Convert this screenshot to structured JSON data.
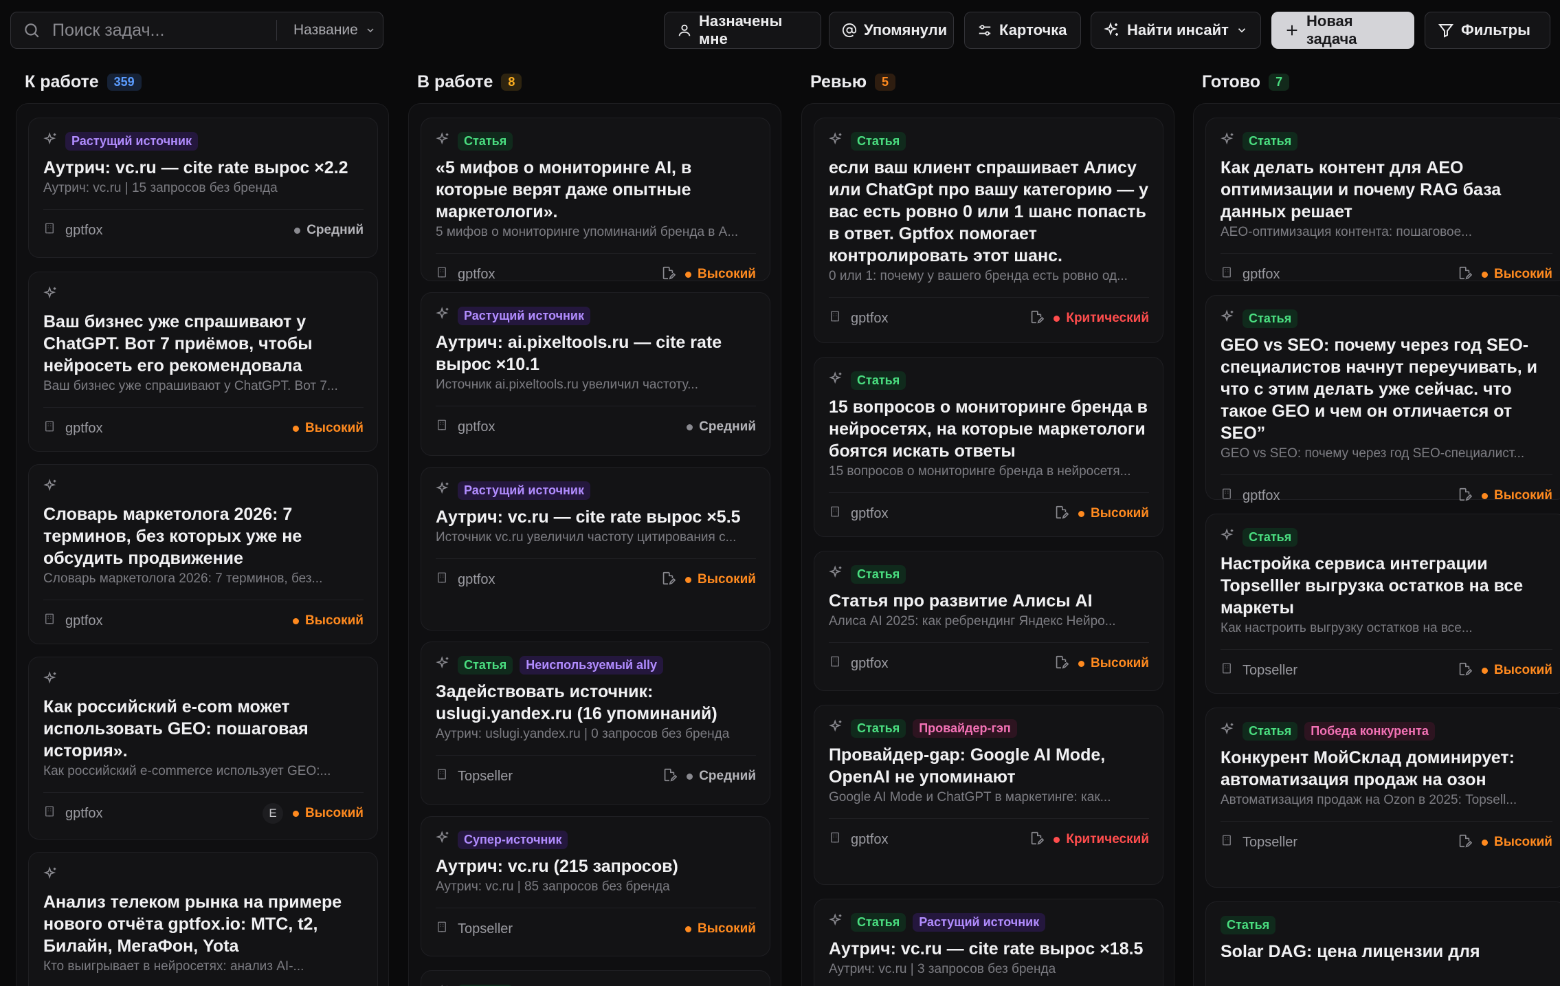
{
  "toolbar": {
    "search_placeholder": "Поиск задач...",
    "search_field": "Название",
    "assigned_label": "Назначены мне",
    "mentioned_label": "Упомянули",
    "card_label": "Карточка",
    "insight_label": "Найти инсайт",
    "new_task_label": "Новая задача",
    "filters_label": "Фильтры"
  },
  "colors": {
    "priority_high": "#ff8a1f",
    "priority_critical": "#ff4d4d",
    "priority_medium": "#8a8a90",
    "count_todo": "#5b9cff",
    "count_progress": "#ffb020",
    "count_review": "#ff8a1f",
    "count_done": "#4ade80"
  },
  "columns": [
    {
      "title": "К работе",
      "count": "359",
      "cards": [
        {
          "tags": [
            "Растущий источник"
          ],
          "title": "Аутрич: vc.ru — cite rate вырос ×2.2",
          "desc": "Аутрич: vc.ru | 15 запросов без бренда",
          "project": "gptfox",
          "priority": "Средний"
        },
        {
          "tags": [],
          "title": "Ваш бизнес уже спрашивают у ChatGPT. Вот 7 приёмов, чтобы нейросеть его рекомендовала",
          "desc": "Ваш бизнес уже спрашивают у ChatGPT. Вот 7...",
          "project": "gptfox",
          "priority": "Высокий"
        },
        {
          "tags": [],
          "title": "Словарь маркетолога 2026: 7 терминов, без которых уже не обсудить продвижение",
          "desc": "Словарь маркетолога 2026: 7 терминов, без...",
          "project": "gptfox",
          "priority": "Высокий"
        },
        {
          "tags": [],
          "title": "Как российский e-com может использовать GEO: пошаговая история».",
          "desc": "Как российский e-commerce использует GEO:...",
          "project": "gptfox",
          "avatar": "E",
          "priority": "Высокий"
        },
        {
          "tags": [],
          "title": "Анализ телеком рынка на примере нового отчёта gptfox.io: МТС, t2, Билайн, МегаФон, Yota",
          "desc": "Кто выигрывает в нейросетях: анализ AI-..."
        }
      ]
    },
    {
      "title": "В работе",
      "count": "8",
      "cards": [
        {
          "tags": [
            "Статья"
          ],
          "title": "«5 мифов о мониторинге AI, в которые верят даже опытные маркетологи».",
          "desc": "5 мифов о мониторинге упоминаний бренда в А...",
          "project": "gptfox",
          "priority": "Высокий"
        },
        {
          "tags": [
            "Растущий источник"
          ],
          "title": "Аутрич: ai.pixeltools.ru — cite rate вырос ×10.1",
          "desc": "Источник ai.pixeltools.ru увеличил частоту...",
          "project": "gptfox",
          "priority": "Средний"
        },
        {
          "tags": [
            "Растущий источник"
          ],
          "title": "Аутрич: vc.ru — cite rate вырос ×5.5",
          "desc": "Источник vc.ru увеличил частоту цитирования с...",
          "project": "gptfox",
          "priority": "Высокий"
        },
        {
          "tags": [
            "Статья",
            "Неиспользуемый ally"
          ],
          "title": "Задействовать источник: uslugi.yandex.ru (16 упоминаний)",
          "desc": "Аутрич: uslugi.yandex.ru | 0 запросов без бренда",
          "project": "Topseller",
          "priority": "Средний"
        },
        {
          "tags": [
            "Супер-источник"
          ],
          "title": "Аутрич: vc.ru (215 запросов)",
          "desc": "Аутрич: vc.ru | 85 запросов без бренда",
          "project": "Topseller",
          "priority": "Высокий"
        },
        {
          "tags": [
            "Статья"
          ]
        }
      ]
    },
    {
      "title": "Ревью",
      "count": "5",
      "cards": [
        {
          "tags": [
            "Статья"
          ],
          "title": "если ваш клиент спрашивает Алису или ChatGpt про вашу категорию — у вас есть ровно 0 или 1 шанс попасть в ответ. Gptfox помогает контролировать этот шанс.",
          "desc": "0 или 1: почему у вашего бренда есть ровно од...",
          "project": "gptfox",
          "priority": "Критический"
        },
        {
          "tags": [
            "Статья"
          ],
          "title": "15 вопросов о мониторинге бренда в нейросетях, на которые маркетологи боятся искать ответы",
          "desc": "15 вопросов о мониторинге бренда в нейросетя...",
          "project": "gptfox",
          "priority": "Высокий"
        },
        {
          "tags": [
            "Статья"
          ],
          "title": "Статья про развитие Алисы AI",
          "desc": "Алиса AI 2025: как ребрендинг Яндекс Нейро...",
          "project": "gptfox",
          "priority": "Высокий"
        },
        {
          "tags": [
            "Статья",
            "Провайдер-гэп"
          ],
          "title": "Провайдер-gap: Google AI Mode, OpenAI не упоминают",
          "desc": "Google AI Mode и ChatGPT в маркетинге: как...",
          "project": "gptfox",
          "priority": "Критический"
        },
        {
          "tags": [
            "Статья",
            "Растущий источник"
          ],
          "title": "Аутрич: vc.ru — cite rate вырос ×18.5",
          "desc": "Аутрич: vc.ru | 3 запросов без бренда"
        }
      ]
    },
    {
      "title": "Готово",
      "count": "7",
      "cards": [
        {
          "tags": [
            "Статья"
          ],
          "title": "Как делать контент для AEO оптимизации и почему RAG база данных решает",
          "desc": "AEO-оптимизация контента: пошаговое...",
          "project": "gptfox",
          "priority": "Высокий"
        },
        {
          "tags": [
            "Статья"
          ],
          "title": "GEO vs SEO: почему через год SEO-специалистов начнут переучивать, и что с этим делать уже сейчас. что такое GEO и чем он отличается от SEO”",
          "desc": "GEO vs SEO: почему через год SEO-специалист...",
          "project": "gptfox",
          "priority": "Высокий"
        },
        {
          "tags": [
            "Статья"
          ],
          "title": "Настройка сервиса интеграции Topselller выгрузка остатков на все маркеты",
          "desc": "Как настроить выгрузку остатков на все...",
          "project": "Topseller",
          "priority": "Высокий"
        },
        {
          "tags": [
            "Статья",
            "Победа конкурента"
          ],
          "title": "Конкурент МойСклад доминирует: автоматизация продаж на озон",
          "desc": "Автоматизация продаж на Ozon в 2025: Topsell...",
          "project": "Topseller",
          "priority": "Высокий"
        },
        {
          "tags": [
            "Статья"
          ],
          "title": "Solar DAG: цена лицензии для"
        }
      ]
    }
  ]
}
